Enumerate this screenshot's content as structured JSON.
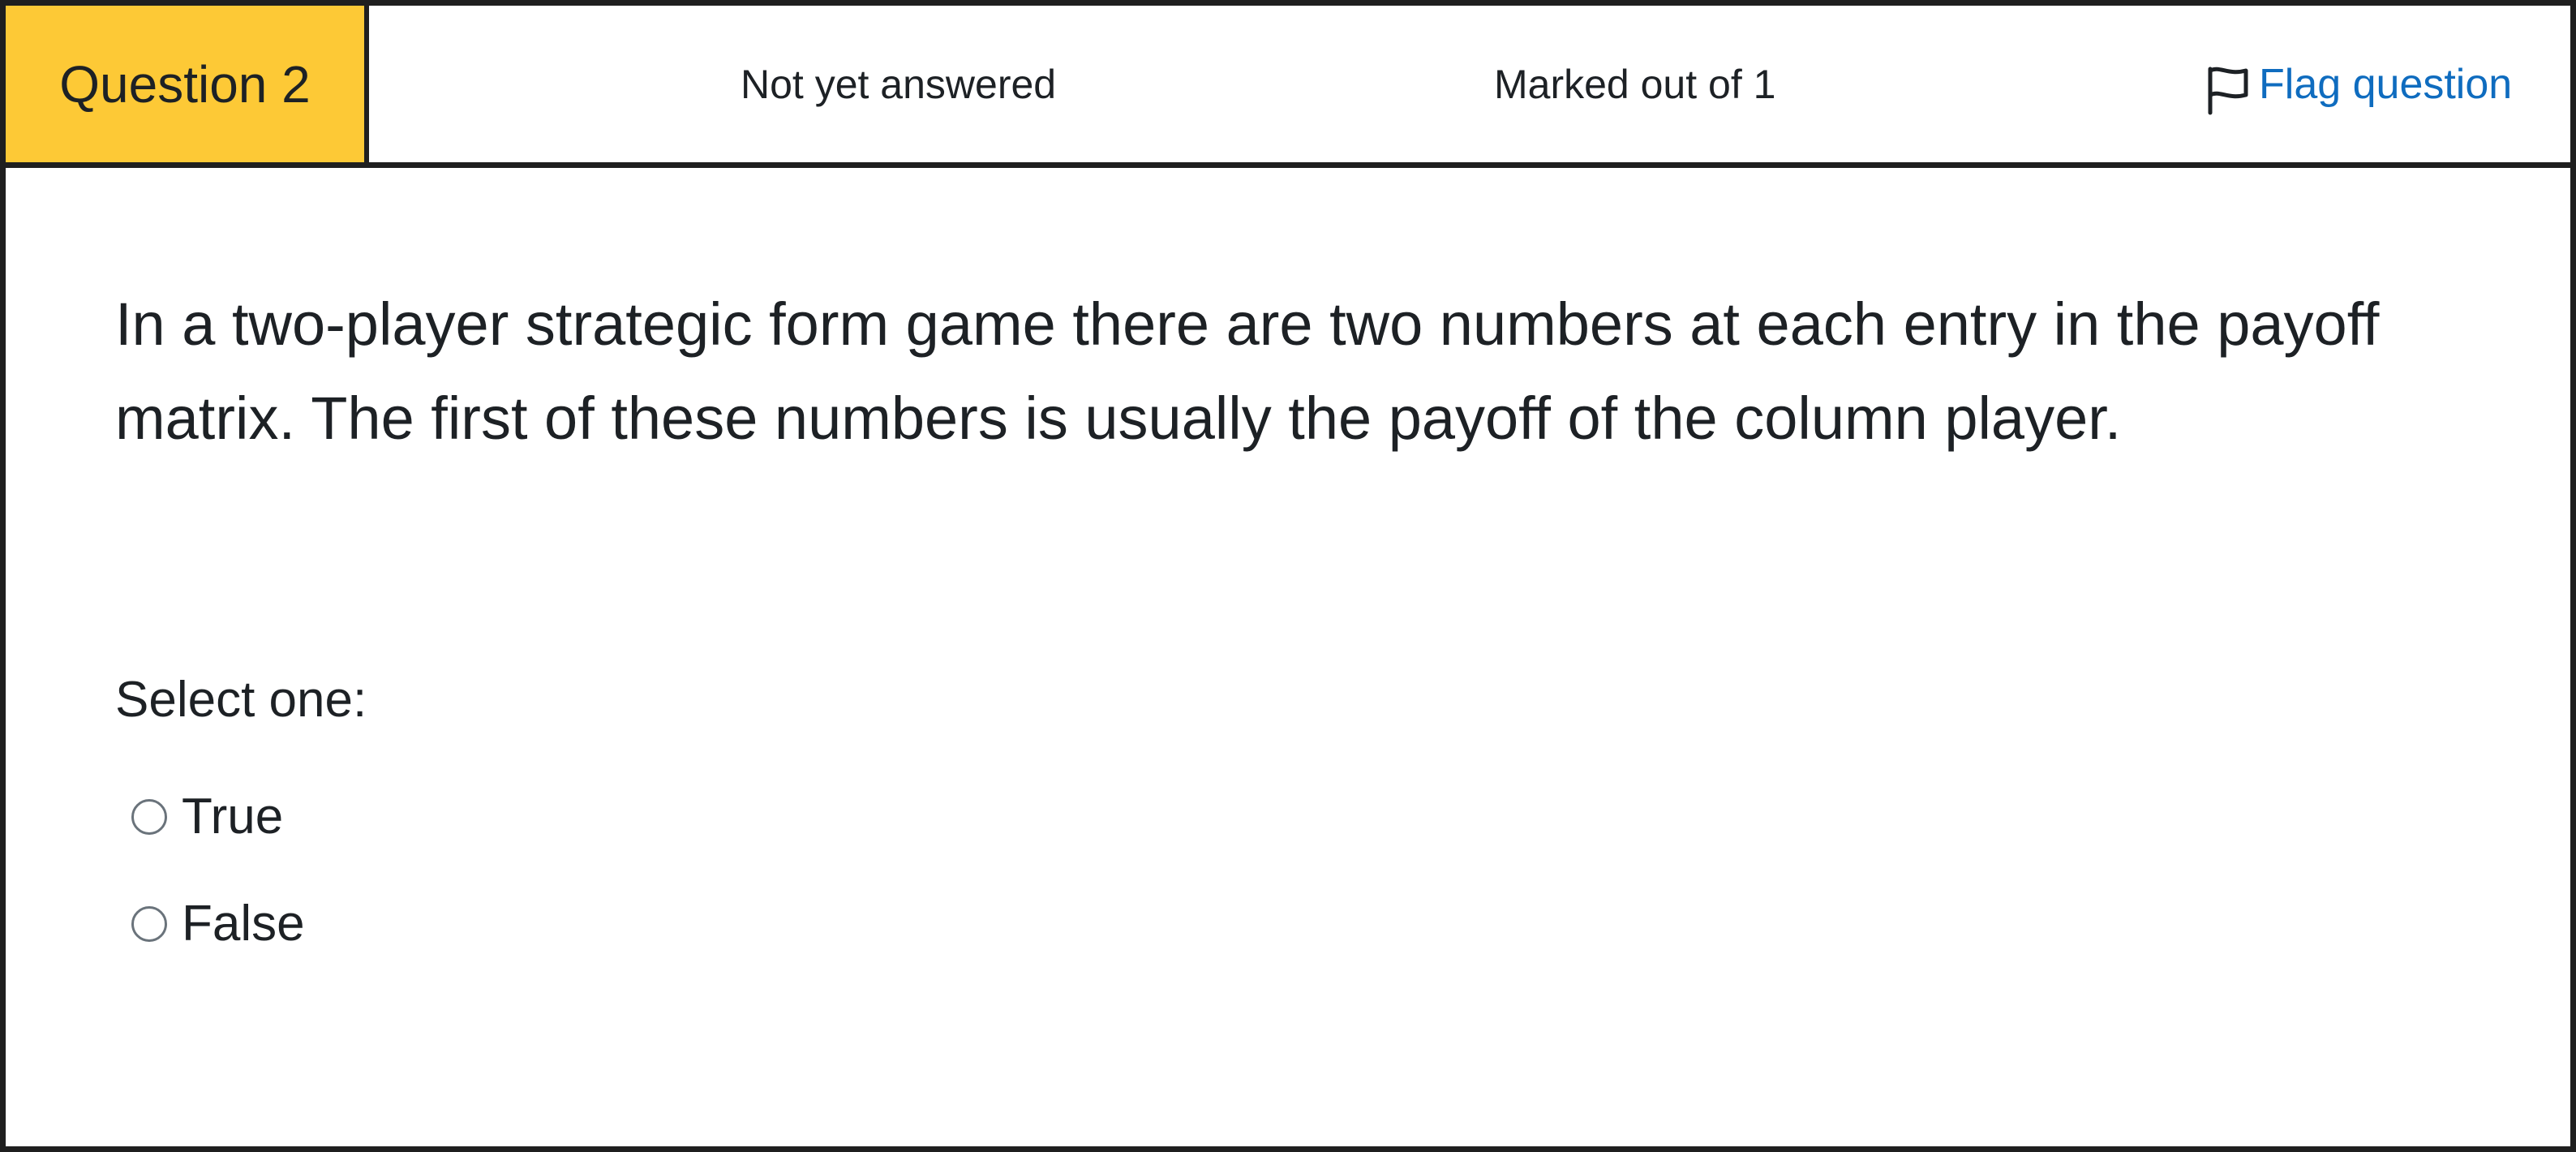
{
  "header": {
    "question_label": "Question 2",
    "status": "Not yet answered",
    "marks": "Marked out of 1",
    "flag_label": "Flag question"
  },
  "question": {
    "text": "In a two-player strategic form game there are two numbers at each entry in the payoff matrix. The first of these numbers is usually the payoff of the column player."
  },
  "answer": {
    "prompt": "Select one:",
    "options": [
      {
        "label": "True",
        "selected": false
      },
      {
        "label": "False",
        "selected": false
      }
    ]
  },
  "colors": {
    "question_badge_bg": "#fdc936",
    "link": "#0f6cbf",
    "border": "#1f1f1f",
    "text": "#1d2125"
  },
  "icons": {
    "flag": "flag-outline-icon"
  }
}
